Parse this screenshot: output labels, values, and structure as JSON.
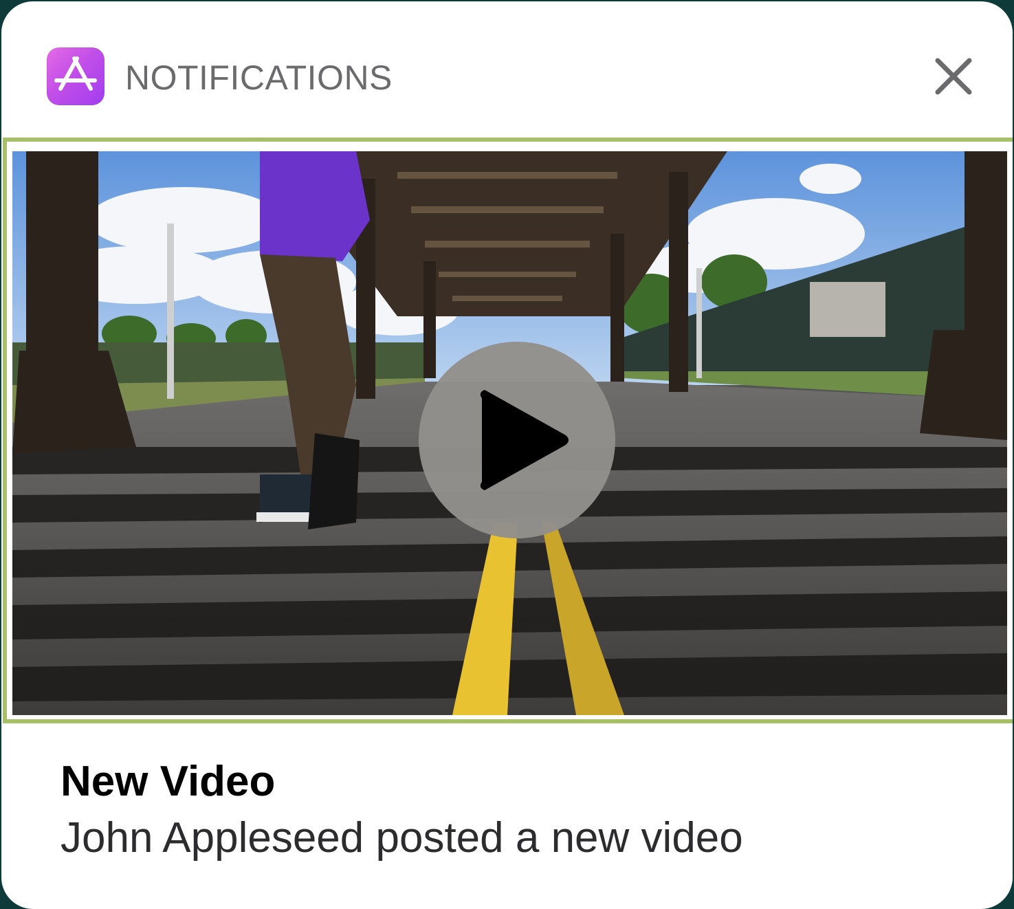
{
  "notification": {
    "app_name": "NOTIFICATIONS",
    "app_icon": "app-store-icon",
    "close_icon": "close-icon",
    "title": "New Video",
    "body": "John Appleseed posted a new video"
  },
  "media": {
    "type": "video",
    "play_icon": "play-icon",
    "frame_color": "#a6c06a"
  },
  "colors": {
    "icon_gradient_start": "#e56be6",
    "icon_gradient_end": "#a13df0",
    "app_name_text": "#6b6b6e",
    "play_button": "#928f8b"
  }
}
